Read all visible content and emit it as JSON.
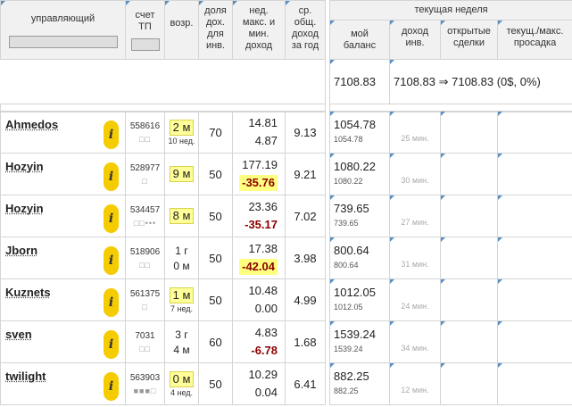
{
  "headers": {
    "manager": "управляющий",
    "account": "счет ТП",
    "age": "возр.",
    "share": "доля дох. для инв.",
    "weekly": "нед. макс. и мин. доход",
    "avg": "ср. общ. доход за год",
    "current_week": "текущая неделя",
    "my_balance": "мой баланс",
    "inv_income": "доход инв.",
    "open_trades": "открытые сделки",
    "drawdown": "текущ./макс. просадка"
  },
  "summary": {
    "my_balance": "7108.83",
    "income_text": "7108.83 ⇒ 7108.83 (0$, 0%)"
  },
  "rows": [
    {
      "name": "Ahmedos",
      "account": "558616",
      "dots": "□□",
      "age": "2 м",
      "age_sub": "10 нед.",
      "share": "70",
      "max": "14.81",
      "min": "4.87",
      "min_style": "plain",
      "avg": "9.13",
      "balance": "1054.78",
      "balance_sub": "1054.78",
      "mins": "25 мин."
    },
    {
      "name": "Hozyin",
      "account": "528977",
      "dots": "□",
      "age": "9 м",
      "age_sub": "",
      "share": "50",
      "max": "177.19",
      "min": "-35.76",
      "min_style": "highlight",
      "avg": "9.21",
      "balance": "1080.22",
      "balance_sub": "1080.22",
      "mins": "30 мин."
    },
    {
      "name": "Hozyin",
      "account": "534457",
      "dots": "□□•••",
      "age": "8 м",
      "age_sub": "",
      "share": "50",
      "max": "23.36",
      "min": "-35.17",
      "min_style": "negative",
      "avg": "7.02",
      "balance": "739.65",
      "balance_sub": "739.65",
      "mins": "27 мин."
    },
    {
      "name": "Jborn",
      "account": "518906",
      "dots": "□□",
      "age": "1 г",
      "age2": "0 м",
      "age_sub": "",
      "share": "50",
      "max": "17.38",
      "min": "-42.04",
      "min_style": "highlight",
      "avg": "3.98",
      "balance": "800.64",
      "balance_sub": "800.64",
      "mins": "31 мин."
    },
    {
      "name": "Kuznets",
      "account": "561375",
      "dots": "□",
      "age": "1 м",
      "age_sub": "7 нед.",
      "share": "50",
      "max": "10.48",
      "min": "0.00",
      "min_style": "plain",
      "avg": "4.99",
      "balance": "1012.05",
      "balance_sub": "1012.05",
      "mins": "24 мин."
    },
    {
      "name": "sven",
      "account": "7031",
      "dots": "□□",
      "age": "3 г",
      "age2": "4 м",
      "age_sub": "",
      "share": "60",
      "max": "4.83",
      "min": "-6.78",
      "min_style": "negative",
      "avg": "1.68",
      "balance": "1539.24",
      "balance_sub": "1539.24",
      "mins": "34 мин."
    },
    {
      "name": "twilight",
      "account": "563903",
      "dots": "■■■□",
      "age": "0 м",
      "age_sub": "4 нед.",
      "share": "50",
      "max": "10.29",
      "min": "0.04",
      "min_style": "plain",
      "avg": "6.41",
      "balance": "882.25",
      "balance_sub": "882.25",
      "mins": "12 мин."
    }
  ],
  "colors": {
    "info_badge": "#f5cc00",
    "age_highlight": "#ffff99",
    "negative_text": "#8b0000",
    "corner_marker": "#5a8fc4"
  },
  "icons": {
    "info": "i"
  }
}
